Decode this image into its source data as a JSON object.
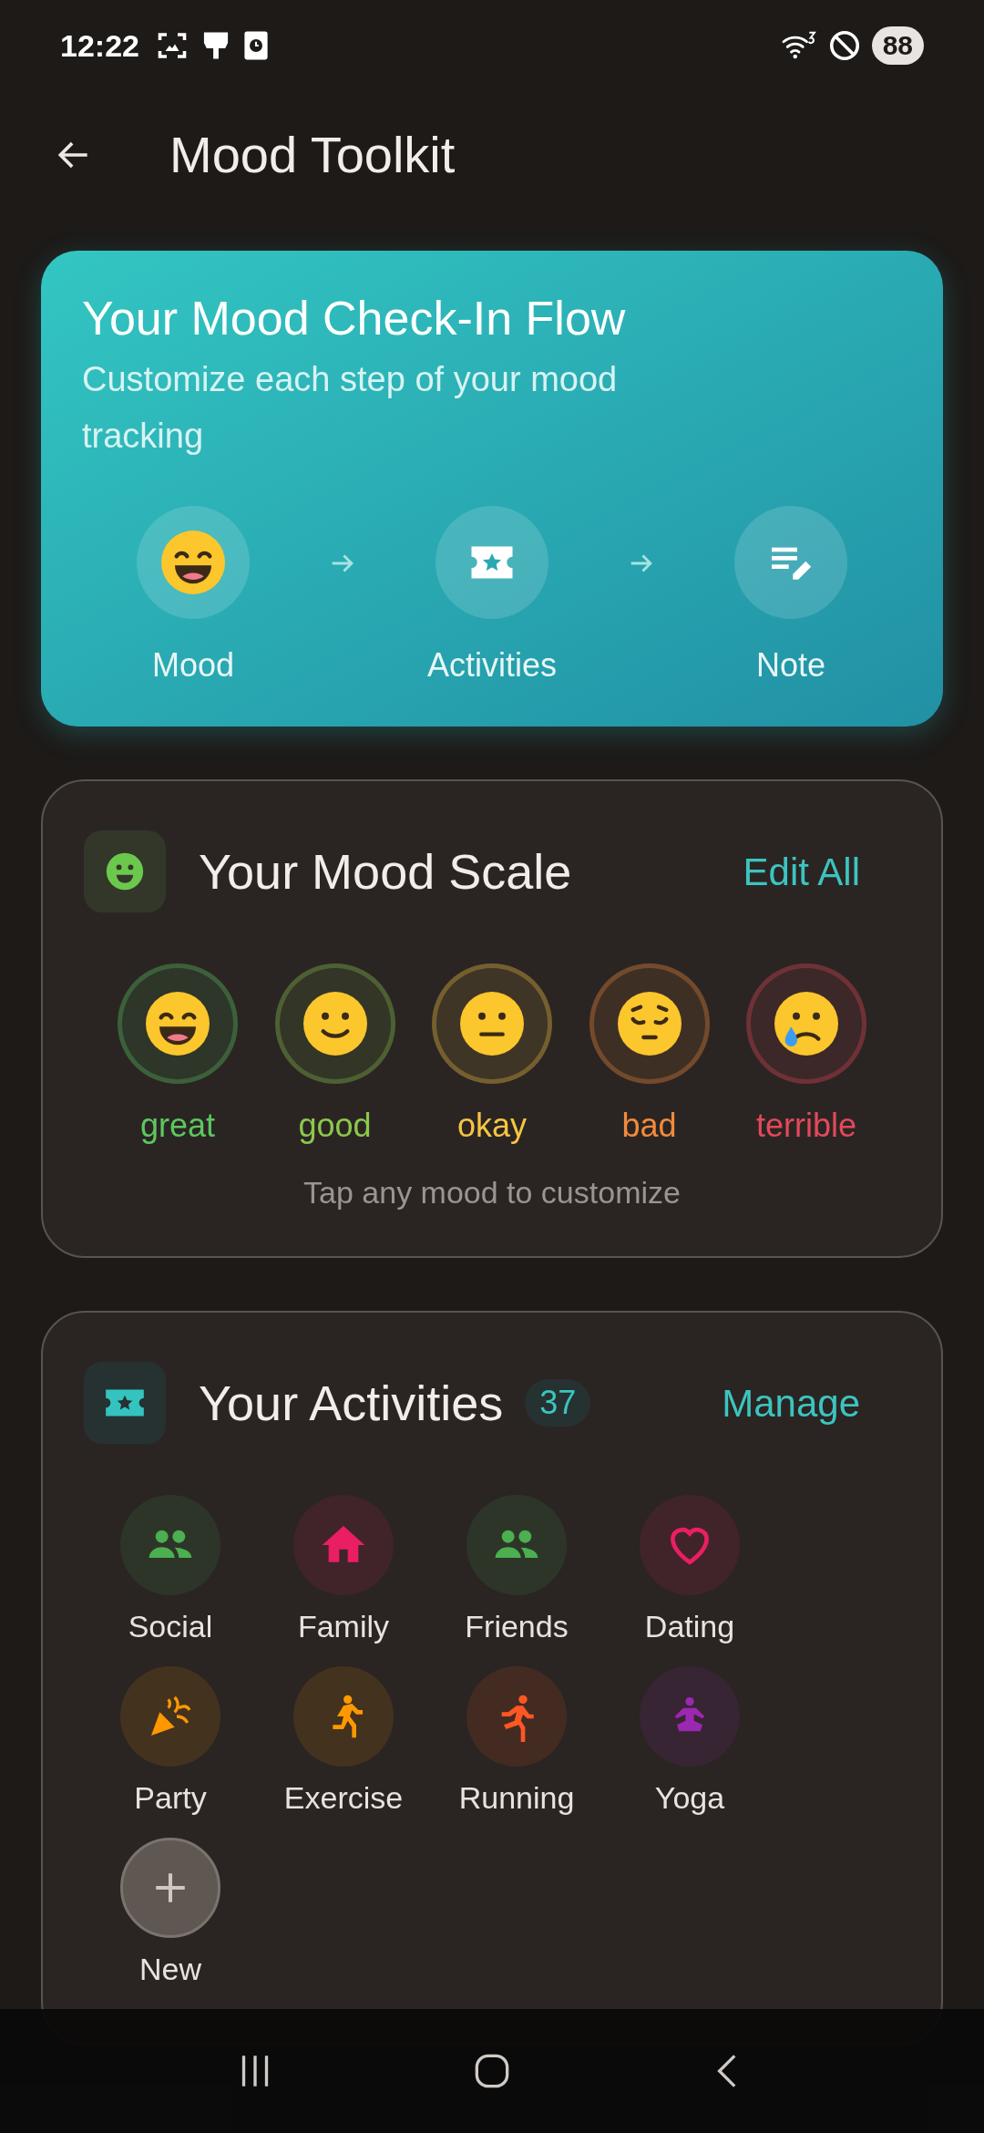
{
  "status_bar": {
    "time": "12:22",
    "battery": "88"
  },
  "header": {
    "title": "Mood Toolkit"
  },
  "flow_card": {
    "title": "Your Mood Check-In Flow",
    "subtitle": "Customize each step of your mood tracking",
    "steps": [
      {
        "label": "Mood",
        "kind": "mood"
      },
      {
        "label": "Activities",
        "kind": "activities"
      },
      {
        "label": "Note",
        "kind": "note"
      }
    ]
  },
  "mood_scale": {
    "title": "Your Mood Scale",
    "action": "Edit All",
    "moods": [
      {
        "label": "great",
        "color": "#5cc85f",
        "kind": "grin"
      },
      {
        "label": "good",
        "color": "#8cc84b",
        "kind": "smile"
      },
      {
        "label": "okay",
        "color": "#f5c542",
        "kind": "neutral"
      },
      {
        "label": "bad",
        "color": "#f28a3c",
        "kind": "pensive"
      },
      {
        "label": "terrible",
        "color": "#e5485a",
        "kind": "crying"
      }
    ],
    "hint": "Tap any mood to customize"
  },
  "activities": {
    "title": "Your Activities",
    "count": "37",
    "action": "Manage",
    "items": [
      {
        "label": "Social",
        "color": "#4caf50",
        "kind": "people"
      },
      {
        "label": "Family",
        "color": "#e91e63",
        "kind": "house"
      },
      {
        "label": "Friends",
        "color": "#4caf50",
        "kind": "people"
      },
      {
        "label": "Dating",
        "color": "#e91e63",
        "kind": "heart"
      },
      {
        "label": "Party",
        "color": "#ff9800",
        "kind": "party"
      },
      {
        "label": "Exercise",
        "color": "#ff9800",
        "kind": "walk"
      },
      {
        "label": "Running",
        "color": "#ff5722",
        "kind": "run"
      },
      {
        "label": "Yoga",
        "color": "#9c27b0",
        "kind": "yoga"
      },
      {
        "label": "New",
        "color": "#cfc8c2",
        "kind": "add"
      }
    ]
  }
}
